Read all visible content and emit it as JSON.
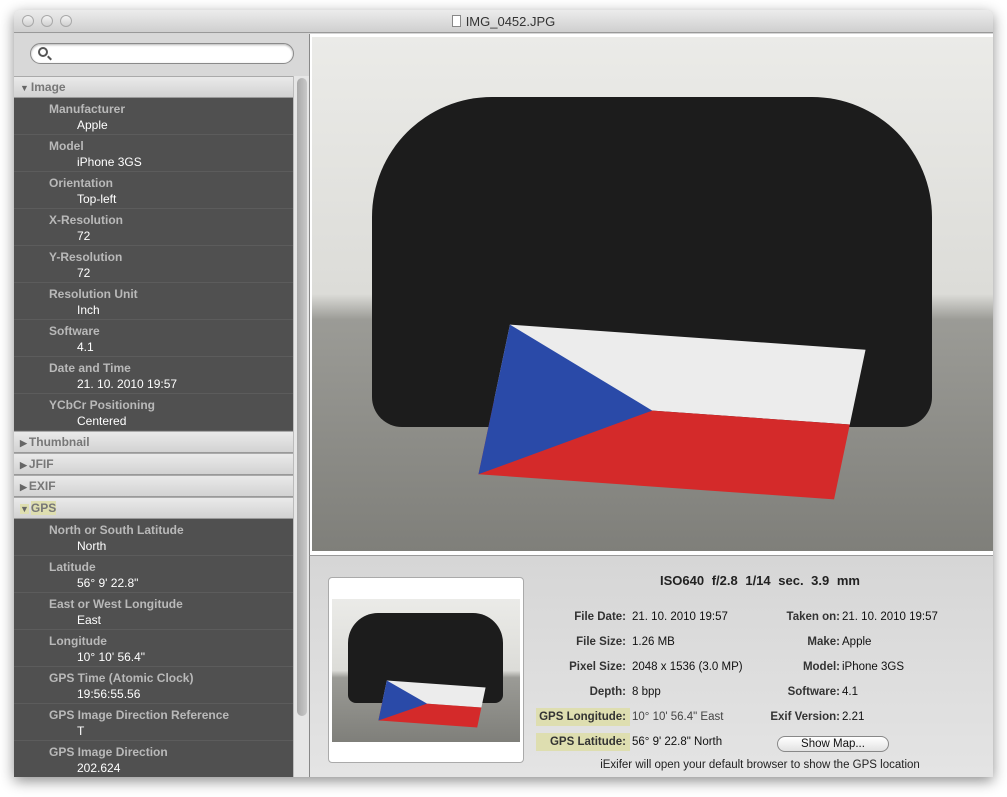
{
  "window": {
    "title": "IMG_0452.JPG"
  },
  "search": {
    "placeholder": ""
  },
  "sections": {
    "image": {
      "label": "Image",
      "items": [
        {
          "key": "Manufacturer",
          "value": "Apple"
        },
        {
          "key": "Model",
          "value": "iPhone 3GS"
        },
        {
          "key": "Orientation",
          "value": "Top-left"
        },
        {
          "key": "X-Resolution",
          "value": "72"
        },
        {
          "key": "Y-Resolution",
          "value": "72"
        },
        {
          "key": "Resolution Unit",
          "value": "Inch"
        },
        {
          "key": "Software",
          "value": "4.1"
        },
        {
          "key": "Date and Time",
          "value": "21. 10. 2010 19:57"
        },
        {
          "key": "YCbCr Positioning",
          "value": "Centered"
        }
      ]
    },
    "thumbnail": {
      "label": "Thumbnail"
    },
    "jfif": {
      "label": "JFIF"
    },
    "exif": {
      "label": "EXIF"
    },
    "gps": {
      "label": "GPS",
      "items": [
        {
          "key": "North or South Latitude",
          "value": "North"
        },
        {
          "key": "Latitude",
          "value": "56° 9' 22.8\""
        },
        {
          "key": "East or West Longitude",
          "value": "East"
        },
        {
          "key": "Longitude",
          "value": "10° 10' 56.4\""
        },
        {
          "key": "GPS Time (Atomic Clock)",
          "value": "19:56:55.56"
        },
        {
          "key": "GPS Image Direction Reference",
          "value": "T"
        },
        {
          "key": "GPS Image Direction",
          "value": "202.624"
        }
      ]
    }
  },
  "summary": {
    "headline": "ISO640  f/2.8  1/14 sec.  3.9 mm",
    "left": [
      {
        "label": "File Date:",
        "value": "21. 10. 2010 19:57"
      },
      {
        "label": "File Size:",
        "value": "1.26 MB"
      },
      {
        "label": "Pixel Size:",
        "value": "2048 x 1536 (3.0 MP)"
      },
      {
        "label": "Depth:",
        "value": "8 bpp"
      },
      {
        "label": "GPS Longitude:",
        "value": "10° 10' 56.4\" East"
      },
      {
        "label": "GPS Latitude:",
        "value": "56° 9' 22.8\" North"
      }
    ],
    "right": [
      {
        "label": "Taken  on:",
        "value": "21. 10. 2010 19:57"
      },
      {
        "label": "Make:",
        "value": "Apple"
      },
      {
        "label": "Model:",
        "value": "iPhone 3GS"
      },
      {
        "label": "Software:",
        "value": "4.1"
      },
      {
        "label": "Exif Version:",
        "value": "2.21"
      }
    ],
    "show_map": "Show Map...",
    "note": "iExifer will open your default browser to show the GPS location"
  }
}
